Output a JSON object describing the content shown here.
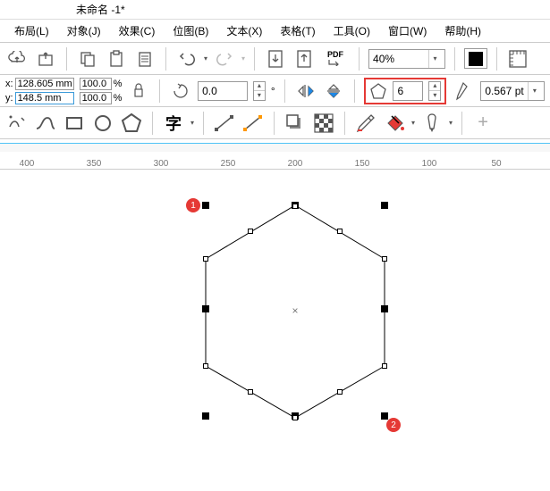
{
  "title": "未命名 -1*",
  "menu": {
    "layout": "布局(L)",
    "object": "对象(J)",
    "effect": "效果(C)",
    "bitmap": "位图(B)",
    "text": "文本(X)",
    "table": "表格(T)",
    "tool": "工具(O)",
    "window": "窗口(W)",
    "help": "帮助(H)"
  },
  "toolbar1": {
    "zoom_value": "40%",
    "pdf_label": "PDF"
  },
  "props": {
    "x_label": "x:",
    "y_label": "y:",
    "width": "128.605 mm",
    "height": "148.5 mm",
    "scale_x": "100.0",
    "scale_y": "100.0",
    "pct": "%",
    "rotation": "0.0",
    "deg": "°",
    "sides": "6",
    "stroke": "0.567 pt"
  },
  "ruler": {
    "t400": "400",
    "t350": "350",
    "t300": "300",
    "t250": "250",
    "t200": "200",
    "t150": "150",
    "t100": "100",
    "t50": "50"
  },
  "badges": {
    "b1": "1",
    "b2": "2"
  }
}
